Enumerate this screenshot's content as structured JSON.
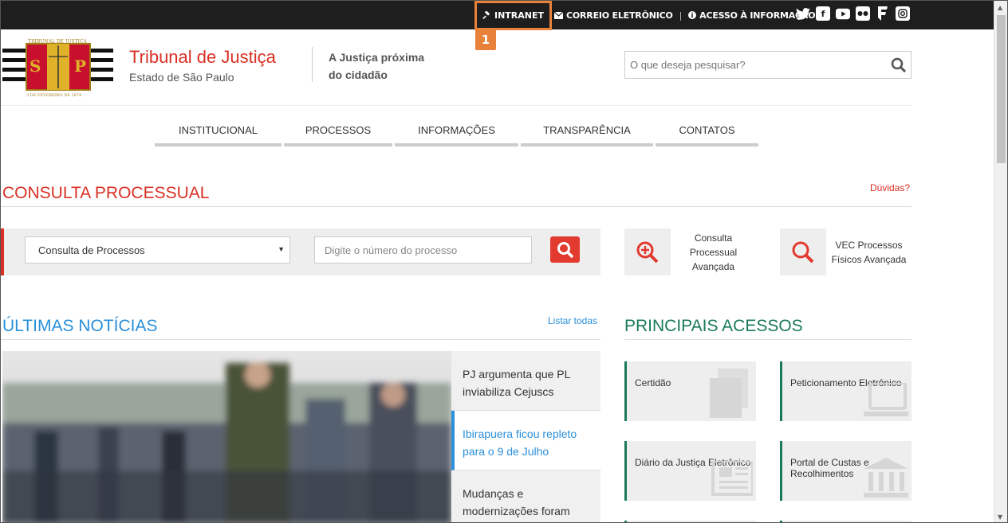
{
  "topbar": {
    "intranet": "INTRANET",
    "email": "CORREIO ELETRÔNICO",
    "separator": "|",
    "access_info": "ACESSO À INFORMAÇÃO",
    "callout": "1",
    "social": [
      "twitter-icon",
      "facebook-icon",
      "youtube-icon",
      "flickr-icon",
      "foursquare-icon",
      "instagram-icon"
    ]
  },
  "header": {
    "logo_top_text": "TRIBUNAL DE JUSTIÇA",
    "logo_letters_left": "S",
    "logo_letters_right": "P",
    "logo_bottom_text": "3 DE FEVEREIRO DE 1874",
    "title": "Tribunal de Justiça",
    "subtitle": "Estado de São Paulo",
    "tagline_line1": "A Justiça próxima",
    "tagline_line2": "do cidadão",
    "search_placeholder": "O que deseja pesquisar?"
  },
  "nav": [
    {
      "label": "INSTITUCIONAL"
    },
    {
      "label": "PROCESSOS"
    },
    {
      "label": "INFORMAÇÕES"
    },
    {
      "label": "TRANSPARÊNCIA"
    },
    {
      "label": "CONTATOS"
    }
  ],
  "consulta": {
    "title": "CONSULTA PROCESSUAL",
    "help_link": "Dúvidas?",
    "select_value": "Consulta de Processos",
    "input_placeholder": "Digite o número do processo",
    "advanced": "Consulta Processual Avançada",
    "vec": "VEC Processos Físicos Avançada"
  },
  "noticias": {
    "title": "ÚLTIMAS NOTÍCIAS",
    "list_all": "Listar todas",
    "items": [
      "PJ argumenta que PL inviabiliza Cejuscs",
      "Ibirapuera ficou repleto para o 9 de Julho",
      "Mudanças e modernizações foram"
    ]
  },
  "acessos": {
    "title": "PRINCIPAIS ACESSOS",
    "items": [
      "Certidão",
      "Peticionamento Eletrônico",
      "Diário da Justiça Eletrônico",
      "Portal de Custas e Recolhimentos"
    ]
  },
  "colors": {
    "red": "#d93025",
    "blue": "#2b8fd9",
    "green": "#1a7a56",
    "highlight": "#e8823a",
    "topbar": "#1e1e1e"
  }
}
